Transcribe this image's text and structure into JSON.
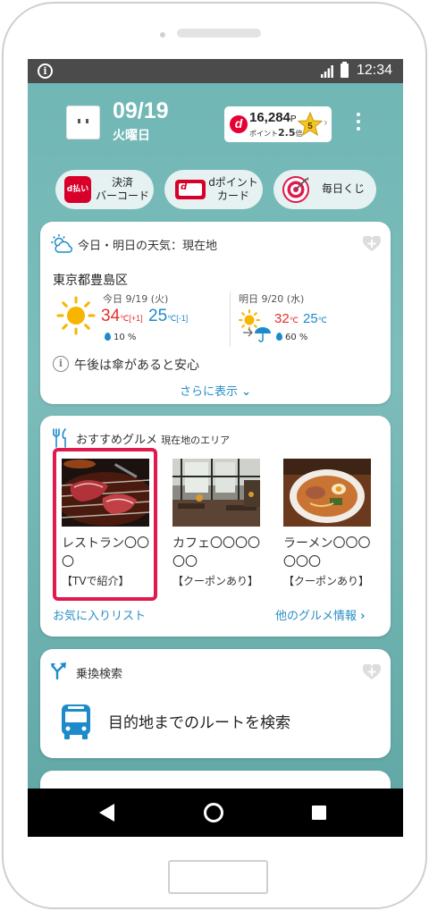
{
  "status": {
    "time": "12:34"
  },
  "header": {
    "date": "09/19",
    "weekday": "火曜日",
    "points": {
      "value": "16,284",
      "unit": "P",
      "rate_prefix": "ポイント",
      "rate": "2.5",
      "rate_suffix": "倍",
      "rank": "5"
    }
  },
  "shortcuts": [
    {
      "label_line1": "決済",
      "label_line2": "バーコード",
      "icon": "d-barai-icon",
      "icon_text": "d払い"
    },
    {
      "label_line1": "dポイント",
      "label_line2": "カード",
      "icon": "dpoint-card-icon"
    },
    {
      "label_line1": "毎日くじ",
      "label_line2": "",
      "icon": "target-icon"
    }
  ],
  "weather": {
    "title": "今日・明日の天気：現在地",
    "location": "東京都豊島区",
    "today": {
      "label": "今日 9/19 (火)",
      "high": "34",
      "high_diff": "[+1]",
      "low": "25",
      "low_diff": "[-1]",
      "unit": "℃",
      "rain": "10 %",
      "icon": "sun-icon"
    },
    "tomorrow": {
      "label": "明日 9/20 (水)",
      "high": "32",
      "low": "25",
      "unit": "℃",
      "rain": "60 %",
      "icon": "sun-to-umbrella-icon"
    },
    "tip": "午後は傘があると安心",
    "more": "さらに表示"
  },
  "gourmet": {
    "title": "おすすめグルメ",
    "subtitle": "現在地のエリア",
    "items": [
      {
        "name": "レストラン〇〇〇",
        "tag": "【TVで紹介】"
      },
      {
        "name": "カフェ〇〇〇〇〇〇",
        "tag": "【クーポンあり】"
      },
      {
        "name": "ラーメン〇〇〇〇〇〇",
        "tag": "【クーポンあり】"
      }
    ],
    "favorites_link": "お気に入りリスト",
    "more_link": "他のグルメ情報"
  },
  "transit": {
    "title": "乗換検索",
    "action": "目的地までのルートを検索"
  },
  "colors": {
    "accent_red": "#e0194e",
    "link_blue": "#2a8fc6",
    "background_teal": "#6fb6b5"
  }
}
